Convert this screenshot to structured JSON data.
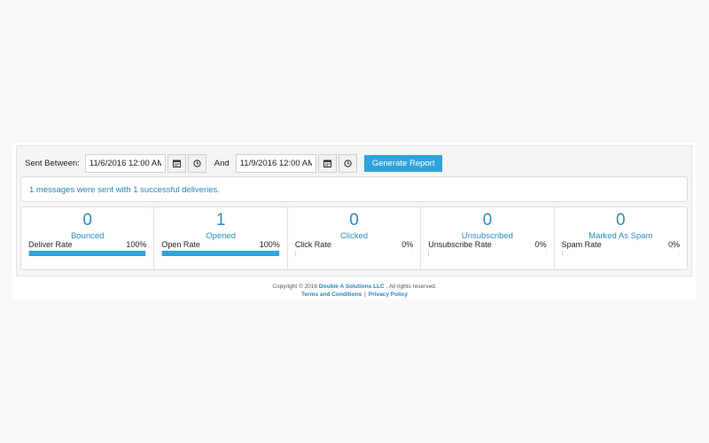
{
  "filters": {
    "sent_between_label": "Sent Between:",
    "start_value": "11/6/2016 12:00 AM",
    "and_label": "And",
    "end_value": "11/9/2016 12:00 AM",
    "generate_label": "Generate Report",
    "button_color": "#2ea3dc"
  },
  "summary": {
    "message": "1 messages were sent with 1 successful deliveries."
  },
  "stats": [
    {
      "count": "0",
      "title": "Bounced",
      "rate_label": "Deliver Rate",
      "rate_text": "100%",
      "rate": 100
    },
    {
      "count": "1",
      "title": "Opened",
      "rate_label": "Open Rate",
      "rate_text": "100%",
      "rate": 100
    },
    {
      "count": "0",
      "title": "Clicked",
      "rate_label": "Click Rate",
      "rate_text": "0%",
      "rate": 0
    },
    {
      "count": "0",
      "title": "Unsubscribed",
      "rate_label": "Unsubscribe Rate",
      "rate_text": "0%",
      "rate": 0
    },
    {
      "count": "0",
      "title": "Marked As Spam",
      "rate_label": "Spam Rate",
      "rate_text": "0%",
      "rate": 0
    }
  ],
  "footer": {
    "copyright_prefix": "Copyright © 2016",
    "company": "Double A Solutions LLC",
    "copyright_suffix": ". All rights reserved.",
    "terms": "Terms and Conditions",
    "separator": "|",
    "privacy": "Privacy Policy"
  },
  "icons": {
    "calendar": "calendar-icon",
    "clock": "clock-icon"
  }
}
